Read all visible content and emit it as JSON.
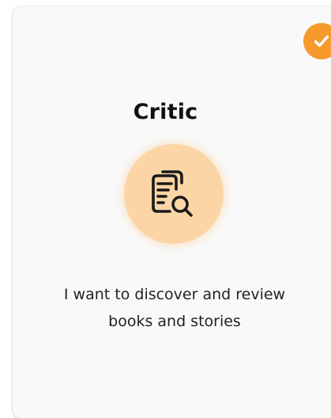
{
  "card": {
    "title": "Critic",
    "description_line1": "I want to discover and review",
    "description_line2": "books and stories",
    "selected": true,
    "icon": "document-search-icon",
    "selected_icon": "check-icon"
  },
  "colors": {
    "accent": "#f79a2e",
    "icon_bg": "#fcd5a6",
    "card_bg": "#f9f9f9",
    "text": "#111111"
  }
}
